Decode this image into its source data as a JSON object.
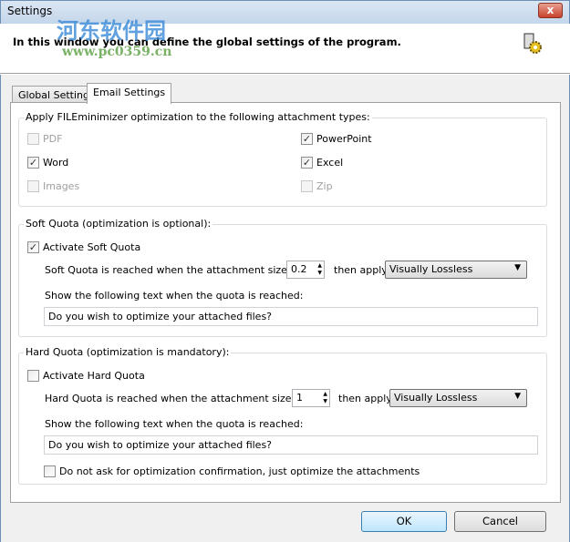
{
  "window": {
    "title": "Settings",
    "close": "x"
  },
  "header": {
    "description": "In this window you can define the global settings of the program."
  },
  "watermark": {
    "name": "河东软件园",
    "url": "www.pc0359.cn"
  },
  "tabs": [
    {
      "label": "Global Settings",
      "active": false
    },
    {
      "label": "Email Settings",
      "active": true
    }
  ],
  "attachments": {
    "title": "Apply FILEminimizer optimization to the following attachment types:",
    "items": [
      {
        "label": "PDF",
        "checked": false,
        "enabled": false
      },
      {
        "label": "PowerPoint",
        "checked": true,
        "enabled": true
      },
      {
        "label": "Word",
        "checked": true,
        "enabled": true
      },
      {
        "label": "Excel",
        "checked": true,
        "enabled": true
      },
      {
        "label": "Images",
        "checked": false,
        "enabled": false
      },
      {
        "label": "Zip",
        "checked": false,
        "enabled": false
      }
    ]
  },
  "soft": {
    "title": "Soft Quota (optimization is optional):",
    "activate": "Activate Soft Quota",
    "checked": true,
    "size_label": "Soft Quota is reached when the attachment size is MB:",
    "size": "0.2",
    "apply_label": "then apply:",
    "method": "Visually Lossless",
    "text_label": "Show the following text when the quota is reached:",
    "text": "Do you wish to optimize your attached files?"
  },
  "hard": {
    "title": "Hard Quota (optimization is mandatory):",
    "activate": "Activate Hard Quota",
    "checked": false,
    "size_label": "Hard Quota is reached when the attachment size is MB:",
    "size": "1",
    "apply_label": "then apply:",
    "method": "Visually Lossless",
    "text_label": "Show the following text when the quota is reached:",
    "text": "Do you wish to optimize your attached files?",
    "noconfirm": "Do not ask for optimization confirmation, just optimize the attachments",
    "noconfirm_checked": false
  },
  "buttons": {
    "ok": "OK",
    "cancel": "Cancel"
  },
  "check_mark": "✓"
}
